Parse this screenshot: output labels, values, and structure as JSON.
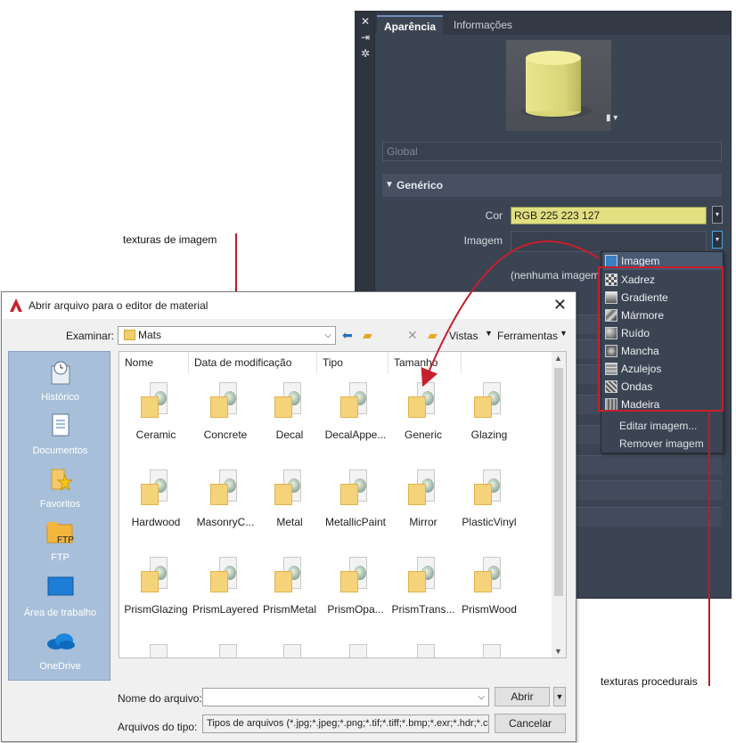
{
  "annotations": {
    "image_textures": "texturas de imagem",
    "procedural_textures": "texturas procedurais"
  },
  "material_editor": {
    "tabs": [
      "Aparência",
      "Informações"
    ],
    "global_placeholder": "Global",
    "section_title": "Genérico",
    "color_label": "Cor",
    "color_value": "RGB 225 223 127",
    "image_label": "Imagem",
    "no_image_text": "(nenhuma imagem",
    "accent_color": "#e1df7f"
  },
  "texture_menu": {
    "items": [
      "Imagem",
      "Xadrez",
      "Gradiente",
      "Mármore",
      "Ruído",
      "Mancha",
      "Azulejos",
      "Ondas",
      "Madeira"
    ],
    "actions": [
      "Editar imagem...",
      "Remover imagem"
    ]
  },
  "dialog": {
    "title": "Abrir arquivo para o editor de material",
    "look_in_label": "Examinar:",
    "look_in_value": "Mats",
    "toolbar": {
      "views": "Vistas",
      "tools": "Ferramentas"
    },
    "places": [
      "Histórico",
      "Documentos",
      "Favoritos",
      "FTP",
      "Área de trabalho",
      "OneDrive"
    ],
    "place_ftp_badge": "FTP",
    "columns": [
      "Nome",
      "Data de modificação",
      "Tipo",
      "Tamanho"
    ],
    "files": [
      "Ceramic",
      "Concrete",
      "Decal",
      "DecalAppe...",
      "Generic",
      "Glazing",
      "Hardwood",
      "MasonryC...",
      "Metal",
      "MetallicPaint",
      "Mirror",
      "PlasticVinyl",
      "PrismGlazing",
      "PrismLayered",
      "PrismMetal",
      "PrismOpa...",
      "PrismTrans...",
      "PrismWood"
    ],
    "file_name_label": "Nome do arquivo:",
    "file_name_value": "",
    "file_type_label": "Arquivos do tipo:",
    "file_type_value": "Tipos de arquivos (*.jpg;*.jpeg;*.png;*.tif;*.tiff;*.bmp;*.exr;*.hdr;*.c",
    "open_button": "Abrir",
    "cancel_button": "Cancelar"
  }
}
